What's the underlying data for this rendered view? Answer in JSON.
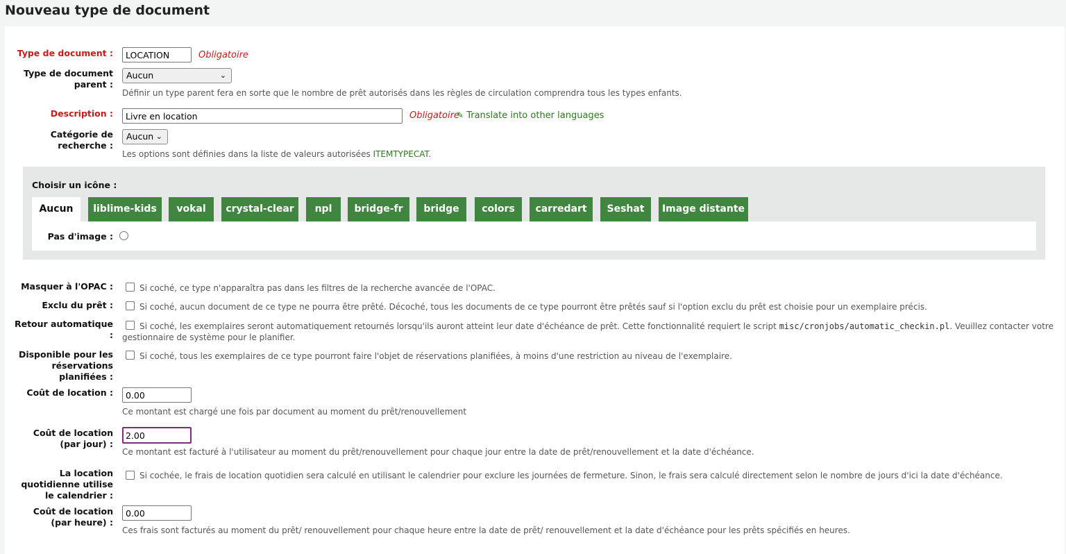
{
  "page_title": "Nouveau type de document",
  "fields": {
    "itemtype": {
      "label": "Type de document :",
      "value": "LOCATION",
      "required_text": "Obligatoire"
    },
    "parent": {
      "label": "Type de document parent :",
      "selected": "Aucun",
      "hint": "Définir un type parent fera en sorte que le nombre de prêt autorisés dans les règles de circulation comprendra tous les types enfants."
    },
    "description": {
      "label": "Description :",
      "value": "Livre en location",
      "required_text": "Obligatoire",
      "translate_link": "Translate into other languages"
    },
    "searchcategory": {
      "label": "Catégorie de recherche :",
      "selected": "Aucun",
      "hint_prefix": "Les options sont définies dans la liste de valeurs autorisées ",
      "hint_link": "ITEMTYPECAT",
      "hint_suffix": "."
    }
  },
  "icon_section": {
    "label": "Choisir un icône :",
    "tabs": [
      "Aucun",
      "liblime-kids",
      "vokal",
      "crystal-clear",
      "npl",
      "bridge-fr",
      "bridge",
      "colors",
      "carredart",
      "Seshat",
      "Image distante"
    ],
    "active_tab": "Aucun",
    "no_image_label": "Pas d'image :"
  },
  "options": {
    "hide_opac": {
      "label": "Masquer à l'OPAC :",
      "hint": "Si coché, ce type n'apparaîtra pas dans les filtres de la recherche avancée de l'OPAC."
    },
    "notforloan": {
      "label": "Exclu du prêt :",
      "hint": "Si coché, aucun document de ce type ne pourra être prêté. Décoché, tous les documents de ce type pourront être prêtés sauf si l'option exclu du prêt est choisie pour un exemplaire précis."
    },
    "automatic_checkin": {
      "label": "Retour automatique :",
      "hint_prefix": "Si coché, les exemplaires seront automatiquement retournés lorsqu'ils auront atteint leur date d'échéance de prêt. Cette fonctionnalité requiert le script ",
      "hint_code": "misc/cronjobs/automatic_checkin.pl",
      "hint_suffix": ". Veuillez contacter votre",
      "hint_line2": "gestionnaire de système pour le planifier."
    },
    "bookable": {
      "label": "Disponible pour les réservations planifiées :",
      "hint": "Si coché, tous les exemplaires de ce type pourront faire l'objet de réservations planifiées, à moins d'une restriction au niveau de l'exemplaire."
    },
    "rentalcharge": {
      "label": "Coût de location :",
      "value": "0.00",
      "hint": "Ce montant est chargé une fois par document au moment du prêt/renouvellement"
    },
    "rentalcharge_daily": {
      "label": "Coût de location (par jour) :",
      "value": "2.00",
      "hint": "Ce montant est facturé à l'utilisateur au moment du prêt/renouvellement pour chaque jour entre la date de prêt/renouvellement et la date d'échéance."
    },
    "daily_calendar": {
      "label": "La location quotidienne utilise le calendrier :",
      "hint": "Si cochée, le frais de location quotidien sera calculé en utilisant le calendrier pour exclure les journées de fermeture. Sinon, le frais sera calculé directement selon le nombre de jours d'ici la date d'échéance."
    },
    "rentalcharge_hourly": {
      "label": "Coût de location (par heure) :",
      "value": "0.00",
      "hint": "Ces frais sont facturés au moment du prêt/ renouvellement pour chaque heure entre la date de prêt/ renouvellement et la date d'échéance pour les prêts spécifiés en heures."
    }
  },
  "colors": {
    "required": "#cc1a1a",
    "tab_green": "#408540",
    "link_green": "#2a7a1e",
    "focus_border": "#7b2d7b"
  }
}
